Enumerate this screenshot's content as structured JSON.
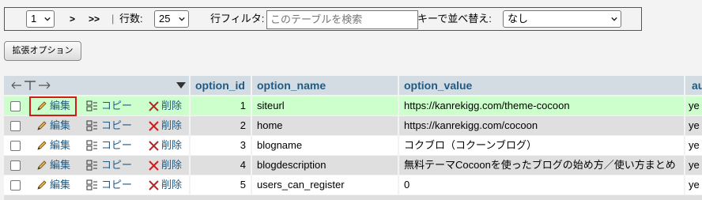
{
  "nav": {
    "page_select": "1",
    "next_label": ">",
    "last_label": ">>",
    "separator": "|",
    "rows_label": "行数:",
    "rows_select": "25",
    "filter_label": "行フィルタ:",
    "filter_placeholder": "このテーブルを検索",
    "sort_label": "キーで並べ替え:",
    "sort_select": "なし"
  },
  "options_button": "拡張オプション",
  "table": {
    "columns": [
      "option_id",
      "option_name",
      "option_value",
      "au"
    ],
    "action_labels": {
      "edit": "編集",
      "copy": "コピー",
      "delete": "削除"
    },
    "rows": [
      {
        "option_id": "1",
        "option_name": "siteurl",
        "option_value": "https://kanrekigg.com/theme-cocoon",
        "autoload": "ye"
      },
      {
        "option_id": "2",
        "option_name": "home",
        "option_value": "https://kanrekigg.com/cocoon",
        "autoload": "ye"
      },
      {
        "option_id": "3",
        "option_name": "blogname",
        "option_value": "コクブロ（コクーンブログ）",
        "autoload": "ye"
      },
      {
        "option_id": "4",
        "option_name": "blogdescription",
        "option_value": "無料テーマCocoonを使ったブログの始め方／使い方まとめ",
        "autoload": "ye"
      },
      {
        "option_id": "5",
        "option_name": "users_can_register",
        "option_value": "0",
        "autoload": "ye"
      }
    ]
  },
  "colors": {
    "header_bg": "#d3dce3",
    "header_text": "#235a81",
    "row_highlight": "#ccffcc",
    "row_even": "#dfdfdf",
    "row_odd": "#ffffff",
    "edit_highlight_border": "#d61a1a"
  }
}
